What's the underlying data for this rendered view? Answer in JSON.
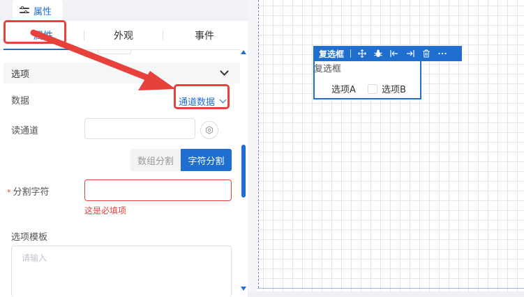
{
  "panel": {
    "top_tab": "属性",
    "tabs": [
      {
        "label": "属性"
      },
      {
        "label": "外观"
      },
      {
        "label": "事件"
      }
    ]
  },
  "section": {
    "title": "选项"
  },
  "form": {
    "data_label": "数据",
    "data_value": "通道数据",
    "read_channel_label": "读通道",
    "read_channel_value": "",
    "split_mode": {
      "options": [
        "数组分割",
        "字符分割"
      ],
      "selected": "字符分割"
    },
    "split_char_label": "分割字符",
    "split_char_value": "",
    "split_char_error": "这是必填项",
    "template_label": "选项模板",
    "template_placeholder": "请输入"
  },
  "canvas": {
    "widget": {
      "toolbar_label": "复选框",
      "toolbar_icons": [
        "move-icon",
        "bug-icon",
        "align-left-icon",
        "align-right-icon",
        "delete-icon",
        "more-icon"
      ],
      "caption": "复选框",
      "options": [
        "选项A",
        "选项B"
      ]
    }
  },
  "colors": {
    "accent": "#1f6fd1",
    "annotation": "#e8403b",
    "error": "#e8403b"
  }
}
